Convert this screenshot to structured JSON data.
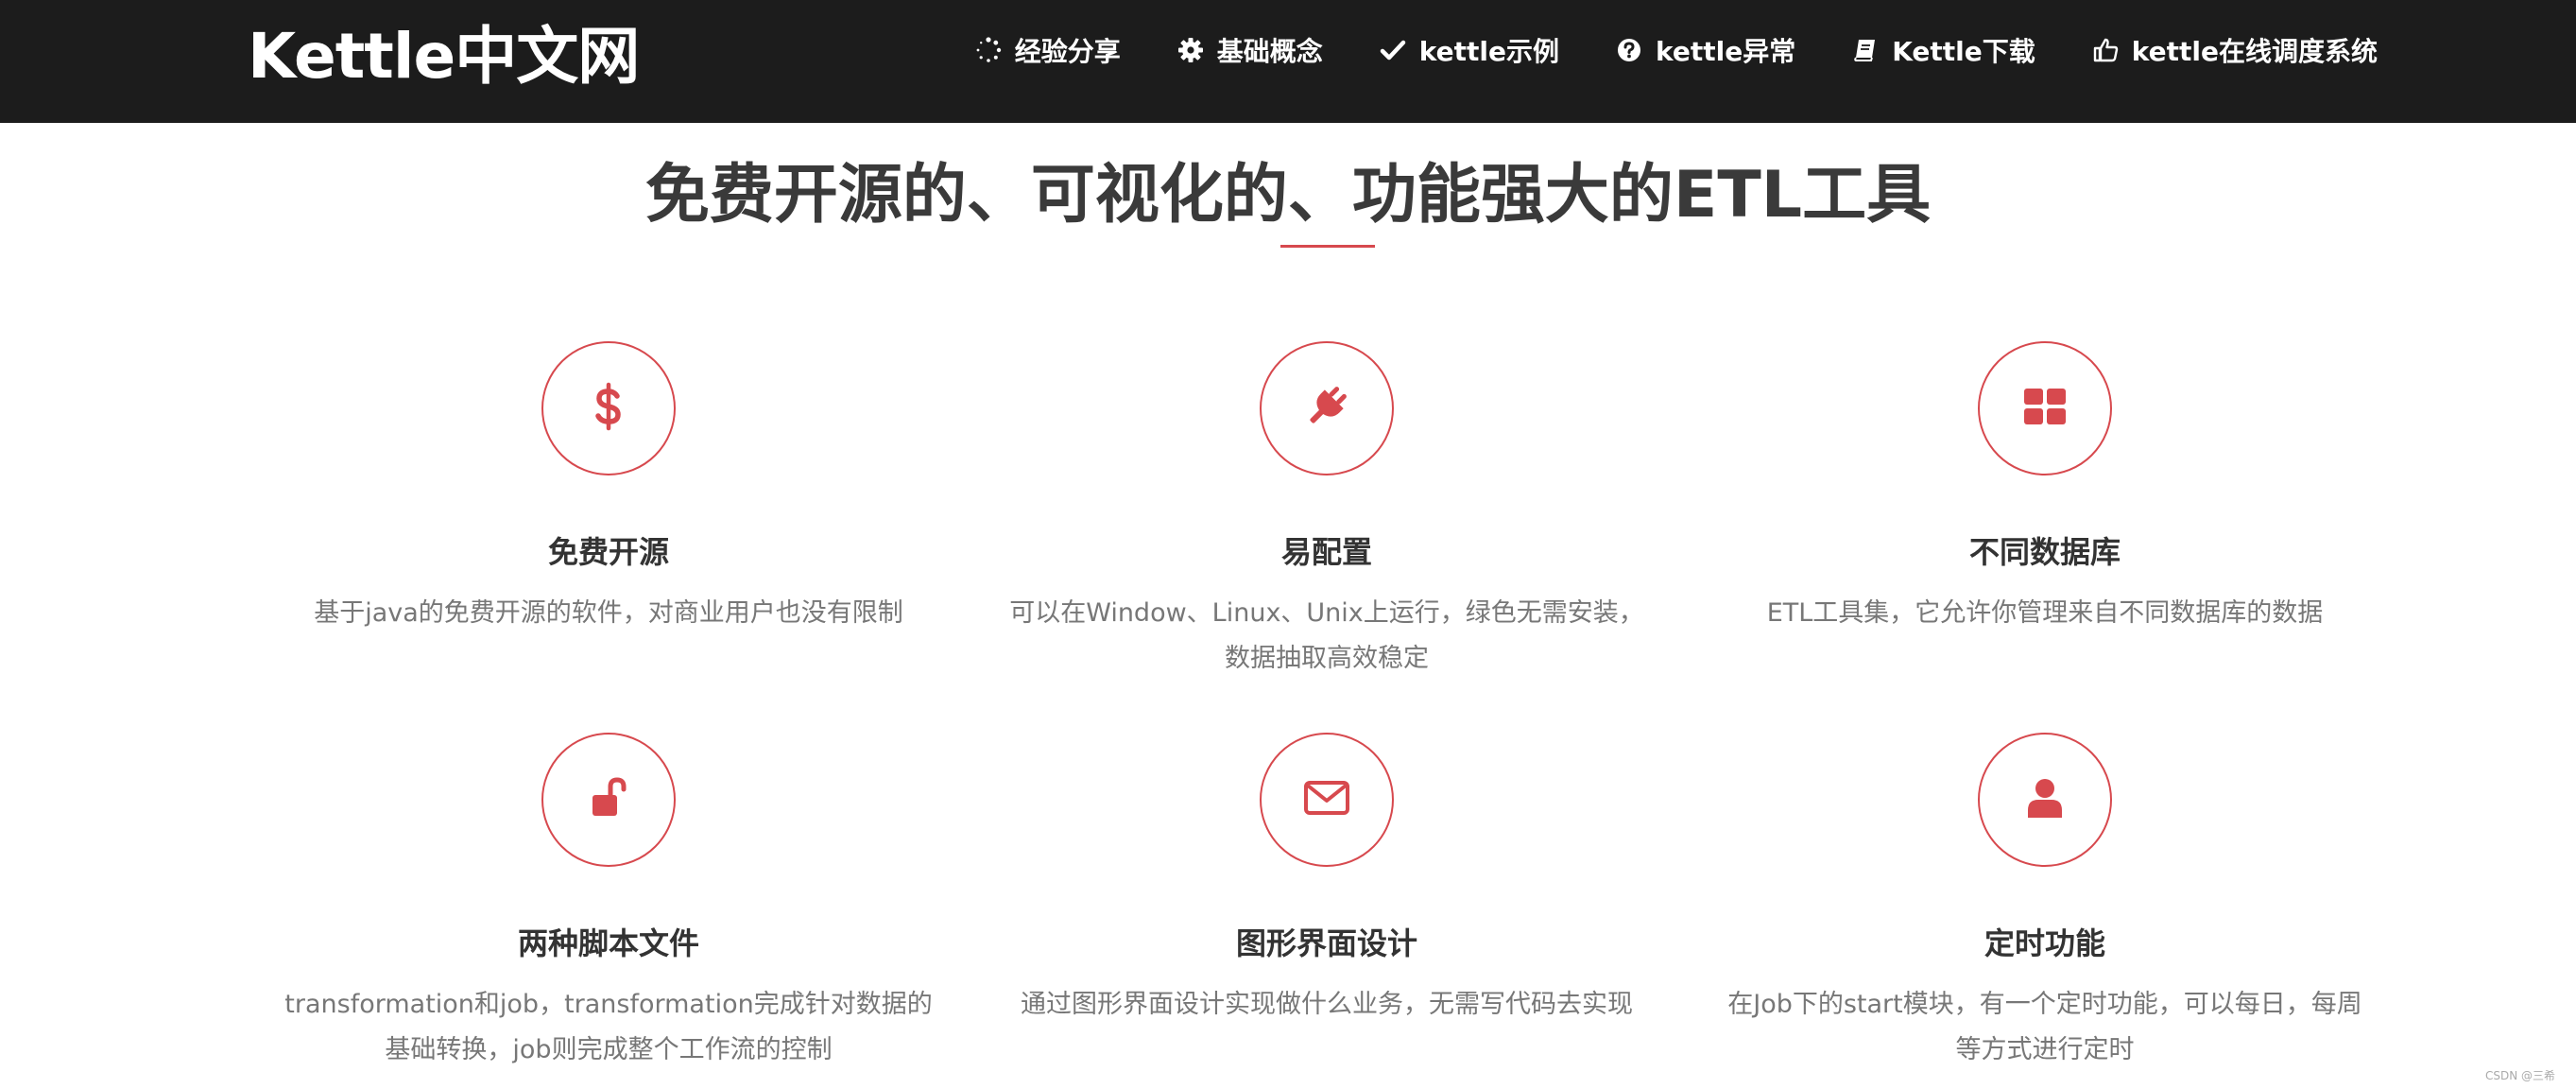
{
  "brand": "Kettle中文网",
  "nav": [
    {
      "icon": "spinner-icon",
      "label": "经验分享"
    },
    {
      "icon": "gear-icon",
      "label": "基础概念"
    },
    {
      "icon": "check-icon",
      "label": "kettle示例"
    },
    {
      "icon": "question-circle-icon",
      "label": "kettle异常"
    },
    {
      "icon": "book-icon",
      "label": "Kettle下载"
    },
    {
      "icon": "hand-pointer-icon",
      "label": "kettle在线调度系统"
    }
  ],
  "headline": "免费开源的、可视化的、功能强大的ETL工具",
  "features": [
    {
      "icon": "dollar-icon",
      "title": "免费开源",
      "line1": "基于java的免费开源的软件，对商业用户也没有限制",
      "line2": ""
    },
    {
      "icon": "plug-icon",
      "title": "易配置",
      "line1": "可以在Window、Linux、Unix上运行，绿色无需安装，",
      "line2": "数据抽取高效稳定"
    },
    {
      "icon": "grid-icon",
      "title": "不同数据库",
      "line1": "ETL工具集，它允许你管理来自不同数据库的数据",
      "line2": ""
    },
    {
      "icon": "unlock-icon",
      "title": "两种脚本文件",
      "line1": "transformation和job，transformation完成针对数据的",
      "line2": "基础转换，job则完成整个工作流的控制"
    },
    {
      "icon": "envelope-icon",
      "title": "图形界面设计",
      "line1": "通过图形界面设计实现做什么业务，无需写代码去实现",
      "line2": ""
    },
    {
      "icon": "user-icon",
      "title": "定时功能",
      "line1": "在Job下的start模块，有一个定时功能，可以每日，每周",
      "line2": "等方式进行定时"
    }
  ],
  "watermark": "CSDN @三希",
  "colors": {
    "accent": "#d7494e",
    "navbar": "#1c1c1c"
  }
}
